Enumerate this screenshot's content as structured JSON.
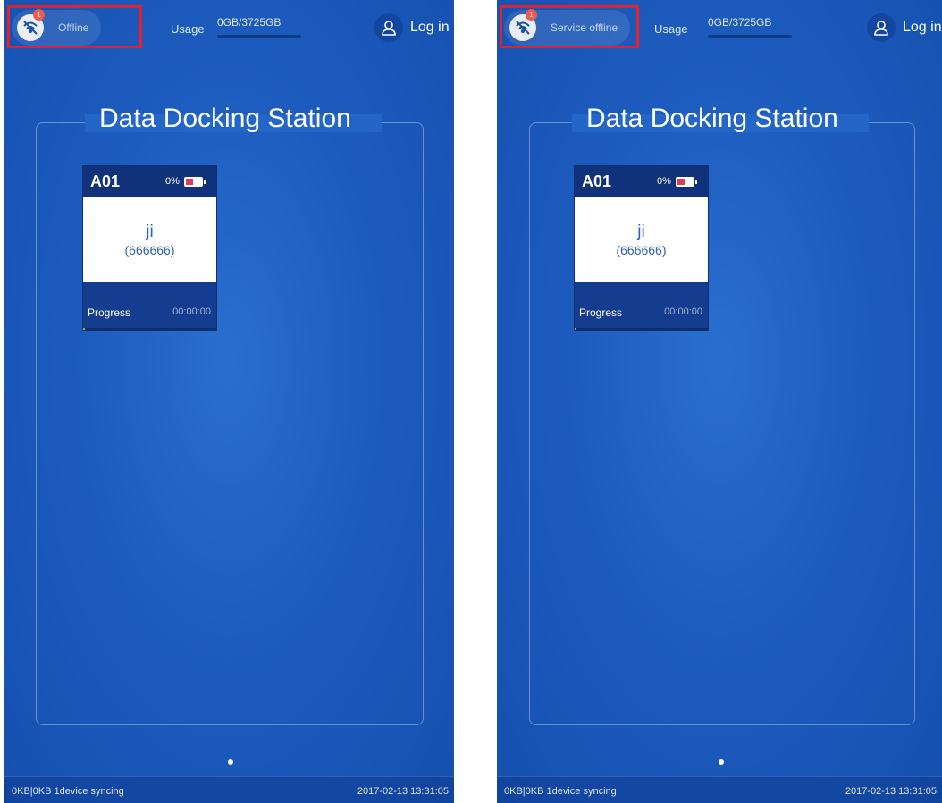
{
  "screens": [
    {
      "status_text": "Offline",
      "notification_count": "1",
      "usage_label": "Usage",
      "usage_value": "0GB/3725GB",
      "usage_fraction": 0.0,
      "login_label": "Log in",
      "title": "Data Docking Station",
      "card": {
        "id": "A01",
        "battery": "0%",
        "name": "ji",
        "code": "(666666)",
        "progress_label": "Progress",
        "time": "00:00:00"
      },
      "footer_left": "0KB|0KB 1device syncing",
      "footer_right": "2017-02-13 13:31:05"
    },
    {
      "status_text": "Service offline",
      "notification_count": "1",
      "usage_label": "Usage",
      "usage_value": "0GB/3725GB",
      "usage_fraction": 0.0,
      "login_label": "Log in",
      "title": "Data Docking Station",
      "card": {
        "id": "A01",
        "battery": "0%",
        "name": "ji",
        "code": "(666666)",
        "progress_label": "Progress",
        "time": "00:00:00"
      },
      "footer_left": "0KB|0KB 1device syncing",
      "footer_right": "2017-02-13 13:31:05"
    }
  ],
  "colors": {
    "highlight": "#e3212b",
    "battery_fill": "#e23a58",
    "progress_fill": "#4ccd54",
    "background": "#1d5cbf"
  }
}
